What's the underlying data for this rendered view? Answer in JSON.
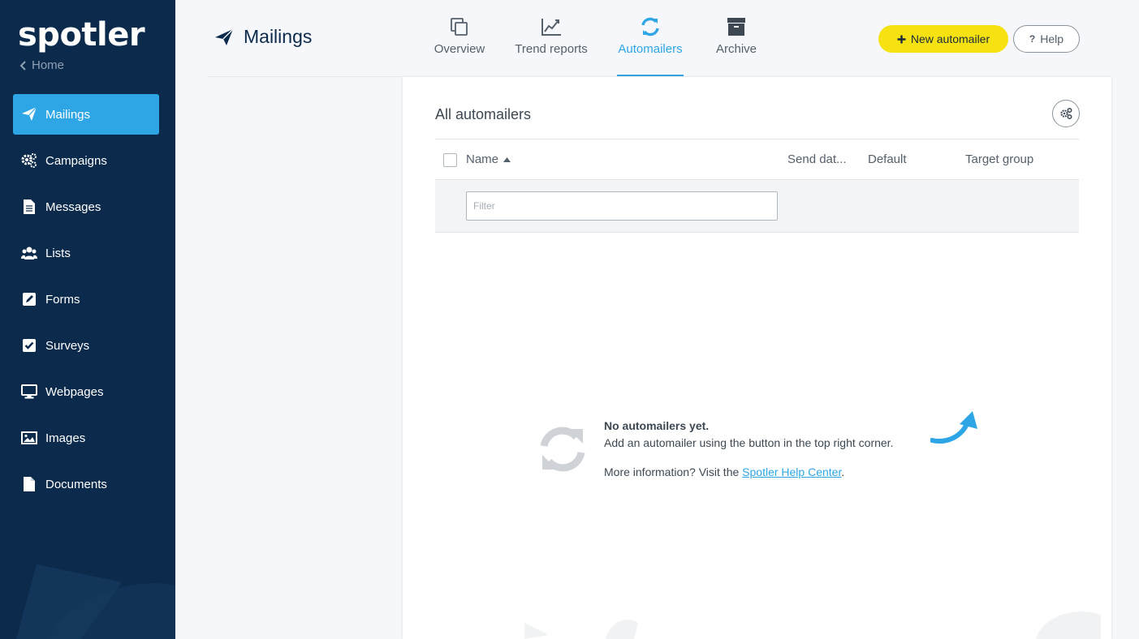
{
  "brand": {
    "name": "spotler"
  },
  "sidebar": {
    "home_label": "Home",
    "items": [
      {
        "label": "Mailings",
        "icon": "paper-plane-icon",
        "active": true
      },
      {
        "label": "Campaigns",
        "icon": "gears-icon"
      },
      {
        "label": "Messages",
        "icon": "document-icon"
      },
      {
        "label": "Lists",
        "icon": "users-icon"
      },
      {
        "label": "Forms",
        "icon": "pencil-square-icon"
      },
      {
        "label": "Surveys",
        "icon": "check-square-icon"
      },
      {
        "label": "Webpages",
        "icon": "monitor-icon"
      },
      {
        "label": "Images",
        "icon": "image-icon"
      },
      {
        "label": "Documents",
        "icon": "file-icon"
      }
    ]
  },
  "header": {
    "title": "Mailings",
    "tabs": [
      {
        "label": "Overview",
        "icon": "copy-icon"
      },
      {
        "label": "Trend reports",
        "icon": "line-chart-icon"
      },
      {
        "label": "Automailers",
        "icon": "refresh-icon",
        "active": true
      },
      {
        "label": "Archive",
        "icon": "archive-box-icon"
      }
    ],
    "new_button": "New automailer",
    "help_button": "Help"
  },
  "panel": {
    "title": "All automailers",
    "columns": {
      "name": "Name",
      "send_date": "Send dat...",
      "default": "Default",
      "target_group": "Target group"
    },
    "filter_placeholder": "Filter",
    "empty": {
      "heading": "No automailers yet.",
      "body": "Add an automailer using the button in the top right corner.",
      "more_prefix": "More information? Visit the ",
      "link_text": "Spotler Help Center",
      "more_suffix": "."
    }
  },
  "colors": {
    "sidebar": "#0c2b4c",
    "accent": "#2ea6e6",
    "primary_button": "#f5e210"
  }
}
